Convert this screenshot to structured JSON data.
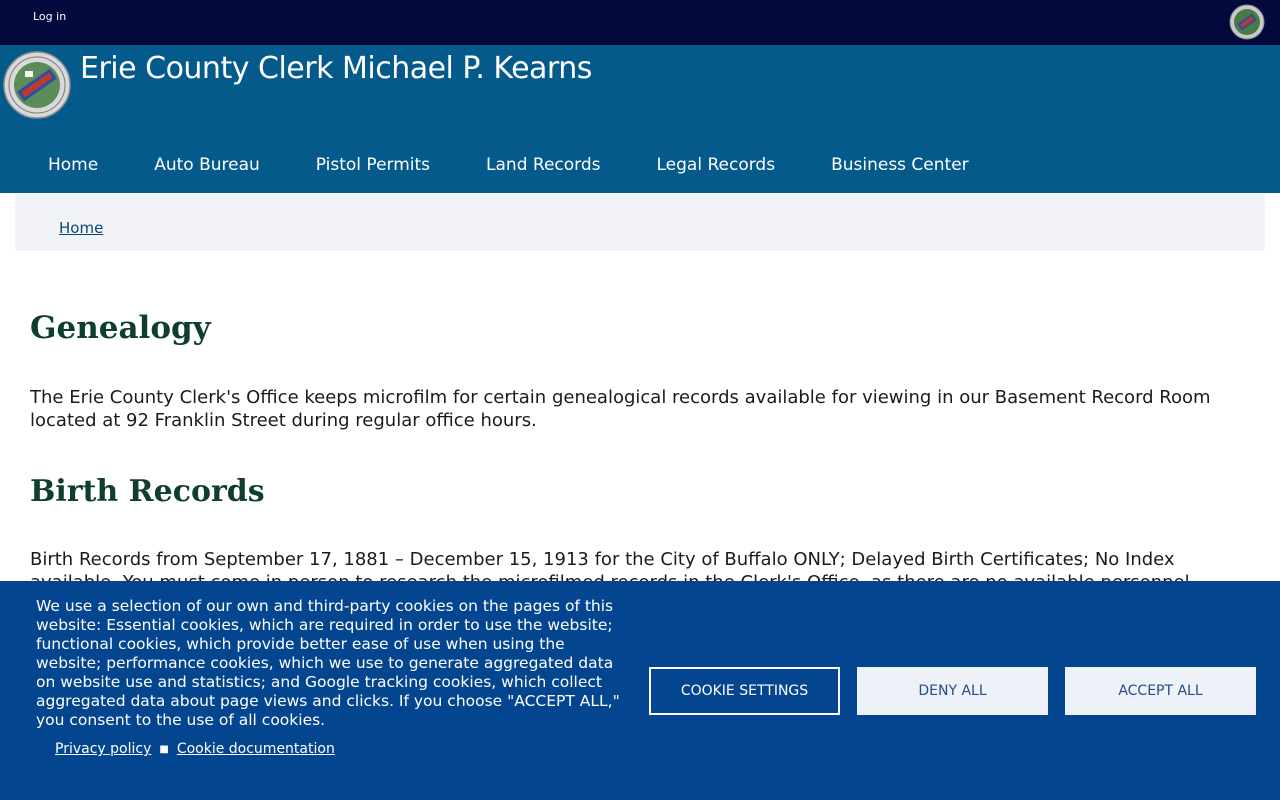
{
  "topbar": {
    "login_label": "Log in"
  },
  "header": {
    "site_title": "Erie County Clerk Michael P. Kearns"
  },
  "nav": {
    "items": [
      {
        "label": "Home"
      },
      {
        "label": "Auto Bureau"
      },
      {
        "label": "Pistol Permits"
      },
      {
        "label": "Land Records"
      },
      {
        "label": "Legal Records"
      },
      {
        "label": "Business Center"
      }
    ]
  },
  "breadcrumb": {
    "home_label": "Home"
  },
  "content": {
    "page_title": "Genealogy",
    "intro": "The Erie County Clerk's Office keeps microfilm for certain genealogical records available for viewing in our Basement Record Room located at 92 Franklin Street during regular office hours.",
    "birth_title": "Birth Records",
    "birth_text": "Birth Records from September 17, 1881 – December 15, 1913 for the City of Buffalo ONLY; Delayed Birth Certificates; No Index available. You must come in person to research the microfilmed records in the Clerk's Office, as there are no available personnel"
  },
  "cookie": {
    "text": "We use a selection of our own and third-party cookies on the pages of this website: Essential cookies, which are required in order to use the website; functional cookies, which provide better ease of use when using the website; performance cookies, which we use to generate aggregated data on website use and statistics; and Google tracking cookies, which collect aggregated data about page views and clicks. If you choose \"ACCEPT ALL,\" you consent to the use of all cookies.",
    "privacy_label": "Privacy policy",
    "cookie_doc_label": "Cookie documentation",
    "settings_label": "COOKIE SETTINGS",
    "deny_label": "DENY ALL",
    "accept_label": "ACCEPT ALL"
  },
  "icons": {
    "seal": "county-seal-icon"
  },
  "colors": {
    "topbar": "#01093d",
    "header": "#055a8c",
    "heading": "#0f3d2e",
    "banner": "#03468f"
  }
}
